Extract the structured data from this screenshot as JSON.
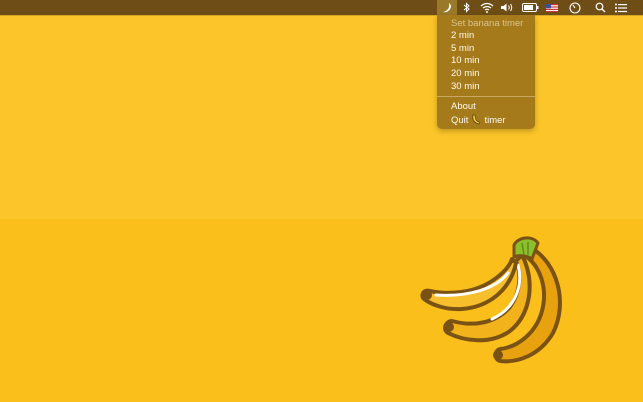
{
  "menubar": {
    "icons": [
      {
        "name": "banana-moon-icon",
        "active": true
      },
      {
        "name": "bluetooth-icon"
      },
      {
        "name": "wifi-icon"
      },
      {
        "name": "volume-icon"
      },
      {
        "name": "battery-icon"
      },
      {
        "name": "us-flag-icon"
      },
      {
        "name": "clock-icon"
      },
      {
        "name": "search-icon"
      },
      {
        "name": "notification-list-icon"
      }
    ]
  },
  "dropdown": {
    "header": "Set banana timer",
    "items": [
      "2 min",
      "5 min",
      "10 min",
      "20 min",
      "30 min"
    ],
    "about": "About",
    "quit_prefix": "Quit",
    "quit_suffix": "timer"
  },
  "colors": {
    "background": "#fcc529",
    "menubar": "#6e4e16",
    "dropdown": "#a47a1b"
  }
}
